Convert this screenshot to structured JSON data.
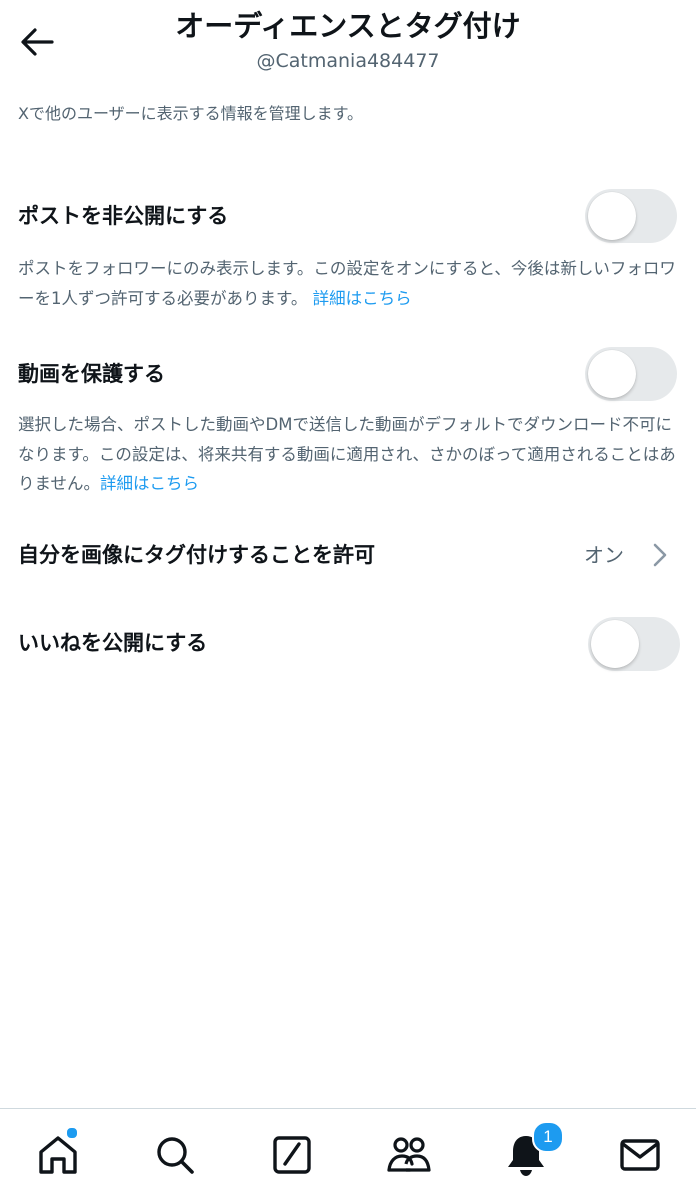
{
  "header": {
    "title": "オーディエンスとタグ付け",
    "username": "@Catmania484477"
  },
  "intro": "Xで他のユーザーに表示する情報を管理します。",
  "settings": {
    "protect_posts": {
      "label": "ポストを非公開にする",
      "enabled": false,
      "description": "ポストをフォロワーにのみ表示します。この設定をオンにすると、今後は新しいフォロワーを1人ずつ許可する必要があります。",
      "link_text": "詳細はこちら"
    },
    "protect_videos": {
      "label": "動画を保護する",
      "enabled": false,
      "description": "選択した場合、ポストした動画やDMで送信した動画がデフォルトでダウンロード不可になります。この設定は、将来共有する動画に適用され、さかのぼって適用されることはありません。",
      "link_text": "詳細はこちら"
    },
    "photo_tagging": {
      "label": "自分を画像にタグ付けすることを許可",
      "value": "オン"
    },
    "public_likes": {
      "label": "いいねを公開にする",
      "enabled": false
    }
  },
  "bottom_nav": {
    "notification_count": "1",
    "icons": [
      "home-icon",
      "search-icon",
      "grok-icon",
      "communities-icon",
      "notifications-bell-icon",
      "messages-envelope-icon"
    ]
  },
  "colors": {
    "accent": "#1d9bf0",
    "text_primary": "#0f1419",
    "text_secondary": "#536471",
    "toggle_off": "#e6e9eb"
  }
}
